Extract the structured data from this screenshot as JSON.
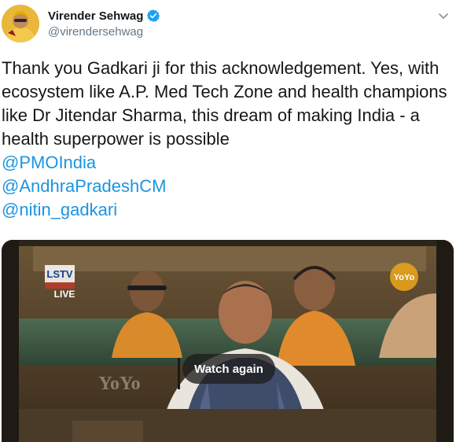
{
  "author": {
    "display_name": "Virender Sehwag",
    "handle": "@virendersehwag",
    "avatar_icon": "avatar-photo",
    "verified_icon": "verified-badge-icon"
  },
  "tweet": {
    "text": "Thank you Gadkari ji for this acknowledgement. Yes, with ecosystem like A.P. Med Tech Zone and health champions like Dr Jitendar Sharma, this dream of making India - a health superpower is possible",
    "mentions": [
      "@PMOIndia",
      "@AndhraPradeshCM",
      "@nitin_gadkari"
    ]
  },
  "media": {
    "watermark_channel": "LSTV",
    "watermark_live": "LIVE",
    "overlay_logo": "YoYo",
    "watch_again_label": "Watch again"
  },
  "colors": {
    "link": "#1b95e0",
    "secondary_text": "#657786",
    "verified": "#1da1f2"
  }
}
